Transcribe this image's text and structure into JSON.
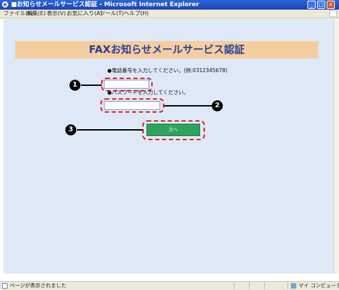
{
  "window": {
    "title": "■お知らせメールサービス認証 - Microsoft Internet Explorer"
  },
  "menubar": {
    "items": [
      "ファイル(F)",
      "編集(E)",
      "表示(V)",
      "お気に入り(A)",
      "ツール(T)",
      "ヘルプ(H)"
    ]
  },
  "page": {
    "header": "FAXお知らせメールサービス認証",
    "instruction_phone": "●電話番号を入力してください。(例:0312345678)",
    "instruction_password": "●パスワードを入力してください。",
    "phone_value": "",
    "password_value": "",
    "submit_label": "次へ"
  },
  "callouts": {
    "marker_1": "1",
    "marker_2": "2",
    "marker_3": "3"
  },
  "statusbar": {
    "text": "ページが表示されました",
    "zone": "マイ コンピュータ"
  },
  "colors": {
    "banner": "#f6cd9e",
    "banner_text": "#27439d",
    "content_bg": "#dfe8f7",
    "submit_button": "#2ea35c",
    "callout_border": "#dd1f27"
  }
}
